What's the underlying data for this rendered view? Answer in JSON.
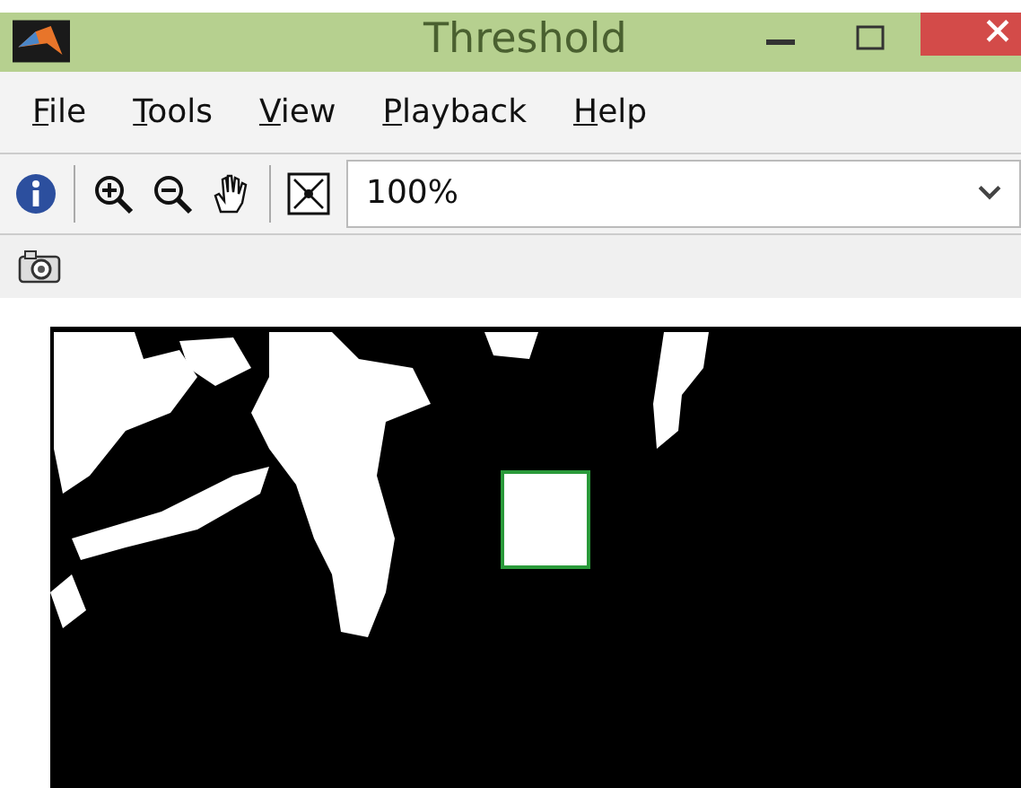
{
  "window": {
    "title": "Threshold"
  },
  "menu": [
    {
      "label": "File"
    },
    {
      "label": "Tools"
    },
    {
      "label": "View"
    },
    {
      "label": "Playback"
    },
    {
      "label": "Help"
    }
  ],
  "toolbar": {
    "zoom": {
      "value": "100%"
    }
  }
}
